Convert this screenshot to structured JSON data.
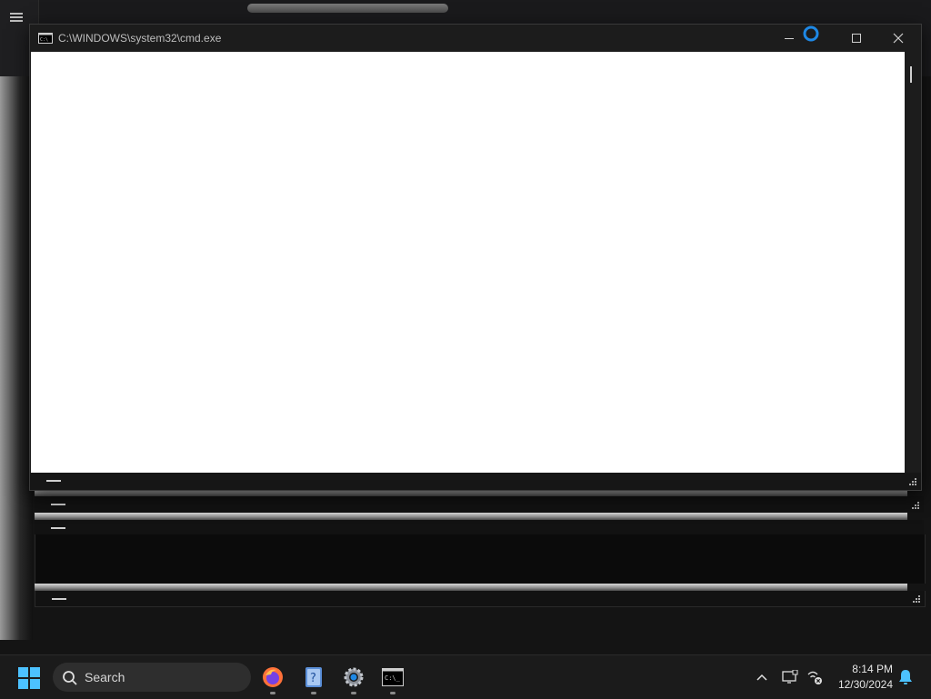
{
  "window": {
    "title": "C:\\WINDOWS\\system32\\cmd.exe",
    "icon": "console-icon",
    "controls": [
      "minimize-icon",
      "maximize-icon",
      "close-icon"
    ]
  },
  "taskbar": {
    "search_label": "Search",
    "apps": [
      "firefox-icon",
      "help-icon",
      "settings-icon",
      "terminal-icon"
    ],
    "tray": [
      "chevron-up-icon",
      "display-icon",
      "network-disconnected-icon",
      "notification-bell-icon"
    ],
    "time": "8:14 PM",
    "date": "12/30/2024"
  },
  "colors": {
    "accent": "#0078d4",
    "console_bg": "#ffffff",
    "titlebar": "#1c1c1c"
  }
}
